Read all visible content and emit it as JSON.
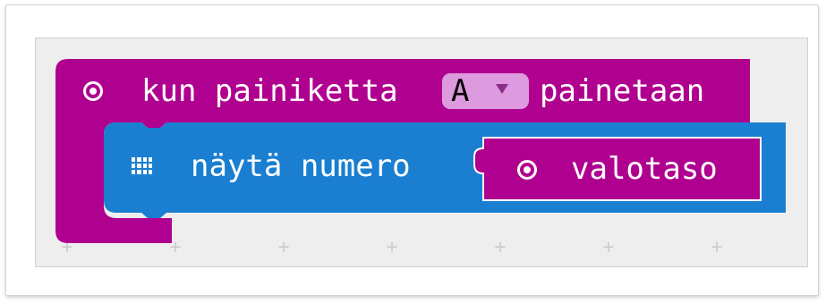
{
  "event_block": {
    "icon": "target-icon",
    "label_before": "kun painiketta",
    "dropdown_value": "A",
    "label_after": "painetaan",
    "color": "#b0008f"
  },
  "show_number_block": {
    "icon": "led-grid-icon",
    "label": "näytä numero",
    "color": "#1a7fd0"
  },
  "light_level_block": {
    "icon": "target-icon",
    "label": "valotaso",
    "color": "#b0008f"
  },
  "workspace": {
    "background": "#eeeeee"
  }
}
